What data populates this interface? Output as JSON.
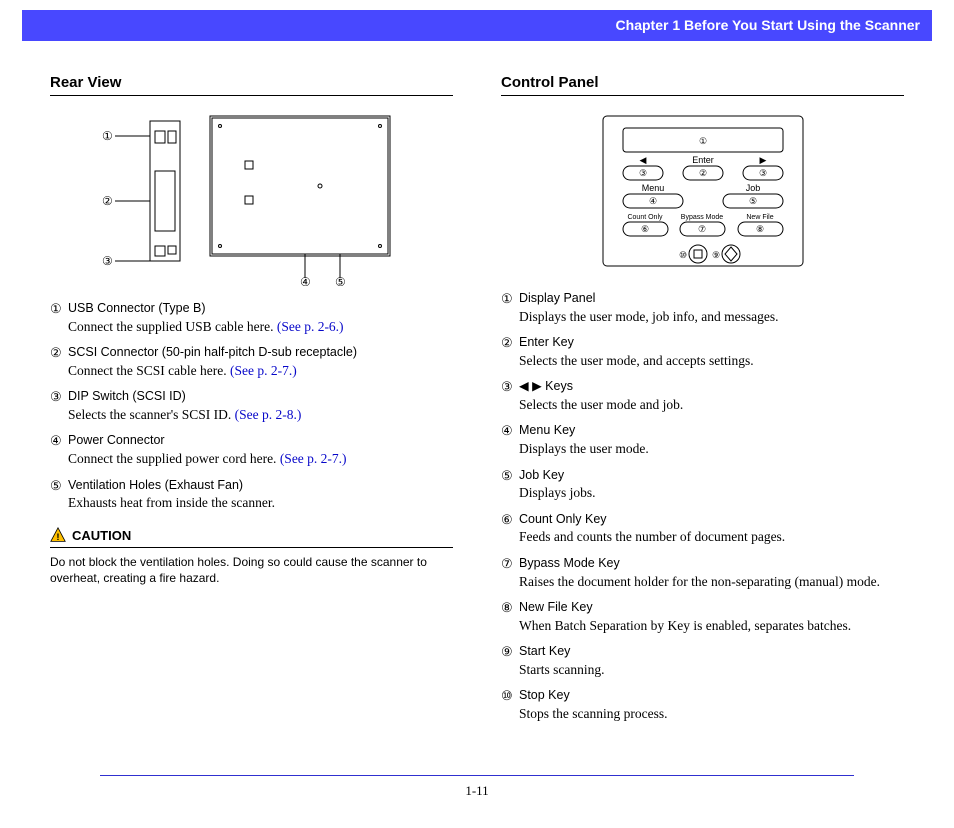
{
  "header": "Chapter 1   Before You Start Using the Scanner",
  "pageNumber": "1-11",
  "left": {
    "title": "Rear View",
    "items": [
      {
        "n": "①",
        "label": "USB Connector (Type B)",
        "desc": "Connect the supplied USB cable here. ",
        "link": "(See p. 2-6.)"
      },
      {
        "n": "②",
        "label": "SCSI Connector (50-pin half-pitch D-sub receptacle)",
        "desc": "Connect the SCSI cable here. ",
        "link": "(See p. 2-7.)"
      },
      {
        "n": "③",
        "label": "DIP Switch (SCSI ID)",
        "desc": "Selects the scanner's SCSI ID. ",
        "link": "(See p. 2-8.)"
      },
      {
        "n": "④",
        "label": "Power Connector",
        "desc": "Connect the supplied power cord here. ",
        "link": "(See p. 2-7.)"
      },
      {
        "n": "⑤",
        "label": "Ventilation Holes (Exhaust Fan)",
        "desc": "Exhausts heat from inside the scanner.",
        "link": ""
      }
    ],
    "cautionLabel": "CAUTION",
    "cautionText": "Do not block the ventilation holes. Doing so could cause the scanner to overheat, creating a fire hazard."
  },
  "right": {
    "title": "Control Panel",
    "panelLabels": {
      "enter": "Enter",
      "menu": "Menu",
      "job": "Job",
      "countOnly": "Count Only",
      "bypass": "Bypass Mode",
      "newFile": "New File"
    },
    "items": [
      {
        "n": "①",
        "label": "Display Panel",
        "desc": "Displays the user mode, job info, and messages."
      },
      {
        "n": "②",
        "label": "Enter Key",
        "desc": "Selects the user mode, and accepts settings."
      },
      {
        "n": "③",
        "label": "◀ ▶ Keys",
        "desc": "Selects the user mode and job."
      },
      {
        "n": "④",
        "label": "Menu Key",
        "desc": "Displays the user mode."
      },
      {
        "n": "⑤",
        "label": "Job Key",
        "desc": "Displays jobs."
      },
      {
        "n": "⑥",
        "label": "Count Only Key",
        "desc": "Feeds and counts the number of document pages."
      },
      {
        "n": "⑦",
        "label": "Bypass Mode Key",
        "desc": "Raises the document holder for the non-separating (manual) mode."
      },
      {
        "n": "⑧",
        "label": "New File Key",
        "desc": "When Batch Separation by Key is enabled, separates batches."
      },
      {
        "n": "⑨",
        "label": "Start Key",
        "desc": "Starts scanning."
      },
      {
        "n": "⑩",
        "label": "Stop Key",
        "desc": "Stops the scanning process."
      }
    ]
  }
}
